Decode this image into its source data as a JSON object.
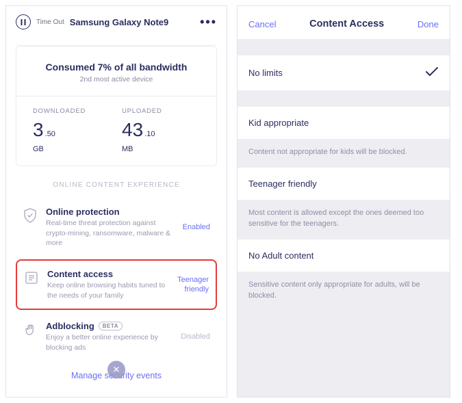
{
  "left": {
    "header": {
      "timeout_label": "Time Out",
      "device_name": "Samsung Galaxy Note9"
    },
    "consumed": {
      "title": "Consumed 7% of all bandwidth",
      "subtitle": "2nd most active device"
    },
    "downloaded": {
      "label": "DOWNLOADED",
      "big": "3",
      "small": ".50",
      "unit": "GB"
    },
    "uploaded": {
      "label": "UPLOADED",
      "big": "43",
      "small": ".10",
      "unit": "MB"
    },
    "section_label": "ONLINE CONTENT EXPERIENCE",
    "features": {
      "protection": {
        "title": "Online protection",
        "desc": "Real-time threat protection against crypto-mining, ransomware, malware & more",
        "status": "Enabled"
      },
      "content_access": {
        "title": "Content access",
        "desc": "Keep online browsing habits tuned to the needs of your family",
        "status_line1": "Teenager",
        "status_line2": "friendly"
      },
      "adblocking": {
        "title": "Adblocking",
        "beta": "BETA",
        "desc": "Enjoy a better online experience by blocking ads",
        "status": "Disabled"
      }
    },
    "footer_link": "Manage security events"
  },
  "right": {
    "nav": {
      "cancel": "Cancel",
      "title": "Content Access",
      "done": "Done"
    },
    "options": {
      "no_limits": {
        "label": "No limits",
        "selected": true
      },
      "kid": {
        "label": "Kid appropriate",
        "desc": "Content not appropriate for kids will be blocked."
      },
      "teen": {
        "label": "Teenager friendly",
        "desc": "Most content is allowed except the ones deemed too sensitive for the teenagers."
      },
      "adult": {
        "label": "No Adult content",
        "desc": "Sensitive content only appropriate for adults, will be blocked."
      }
    }
  }
}
